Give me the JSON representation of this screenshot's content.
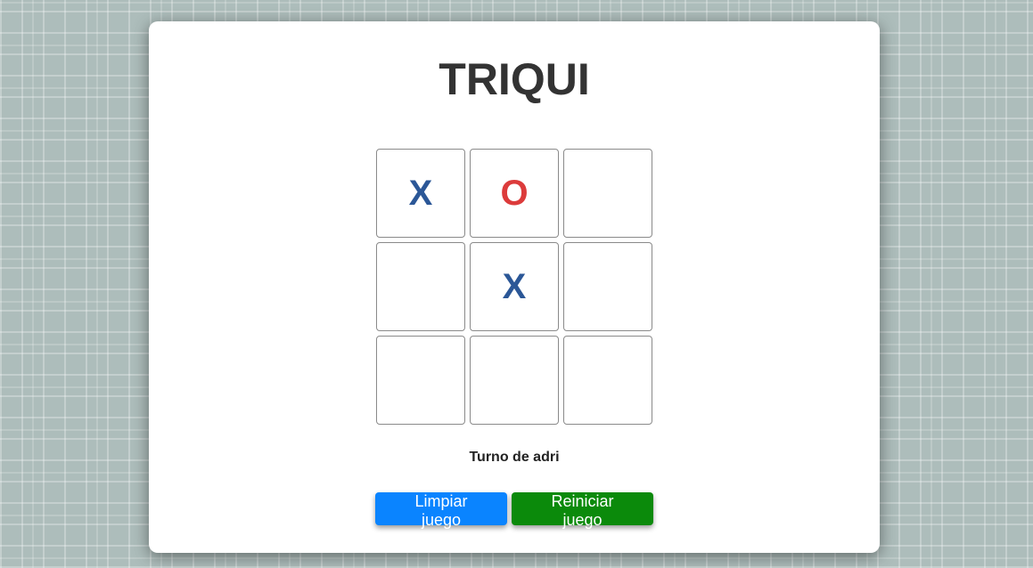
{
  "game": {
    "title": "TRIQUI",
    "board": [
      "X",
      "O",
      "",
      "",
      "X",
      "",
      "",
      "",
      ""
    ],
    "status": "Turno de adri"
  },
  "controls": {
    "clear_label": "Limpiar juego",
    "reset_label": "Reiniciar juego"
  },
  "colors": {
    "x_mark": "#2b5797",
    "o_mark": "#dc3b3b",
    "clear_button": "#0a84ff",
    "reset_button": "#0b8a0b",
    "background": "#adbdbb"
  }
}
